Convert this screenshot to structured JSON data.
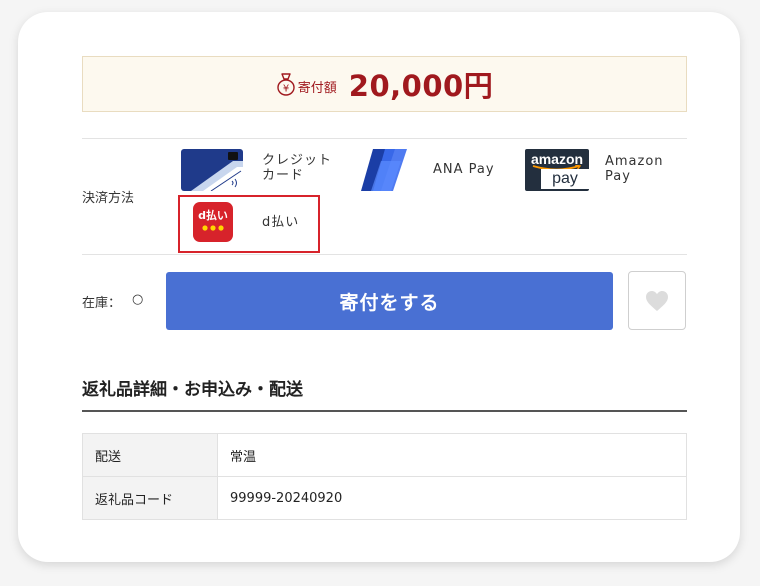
{
  "donation": {
    "label": "寄付額",
    "amount": "20,000円"
  },
  "payment": {
    "label": "決済方法",
    "methods": [
      {
        "name": "クレジット\nカード",
        "icon": "credit-card-icon"
      },
      {
        "name": "ANA Pay",
        "icon": "ana-pay-icon"
      },
      {
        "name": "Amazon\nPay",
        "icon": "amazon-pay-icon",
        "logo_top": "amazon",
        "logo_bottom": "pay"
      },
      {
        "name": "d払い",
        "icon": "d-barai-icon",
        "logo_text": "d払い"
      }
    ]
  },
  "stock": {
    "label": "在庫：",
    "value": "○"
  },
  "donate_button": "寄付をする",
  "section": {
    "title": "返礼品詳細・お申込み・配送"
  },
  "details": [
    {
      "label": "配送",
      "value": "常温"
    },
    {
      "label": "返礼品コード",
      "value": "99999-20240920"
    }
  ],
  "colors": {
    "accent": "#4970d3",
    "amount": "#a0191e",
    "highlight": "#d7232b",
    "d_barai": "#d7232b"
  }
}
